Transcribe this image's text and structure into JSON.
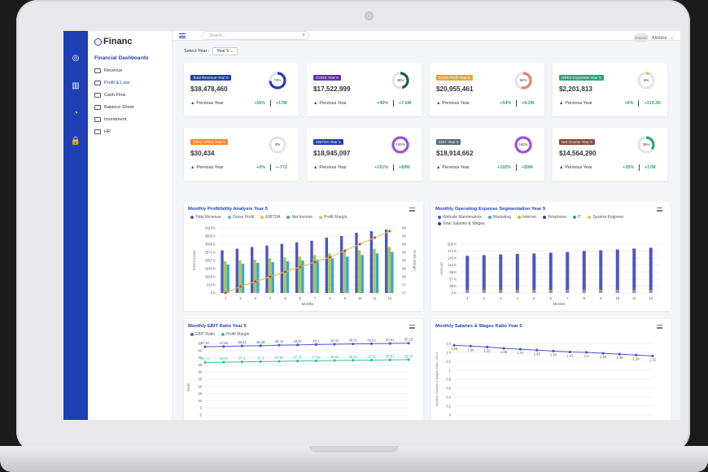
{
  "app": {
    "logo": "Financ",
    "section_title": "Financial Dashboards"
  },
  "sidebar": {
    "items": [
      {
        "label": "Revenue"
      },
      {
        "label": "Profit & Loss"
      },
      {
        "label": "Cash Flow"
      },
      {
        "label": "Balance Sheet"
      },
      {
        "label": "Investment"
      },
      {
        "label": "HR"
      }
    ]
  },
  "topbar": {
    "search_placeholder": "Search...",
    "user_name": "Alishba",
    "avatar_text": "FINANCE"
  },
  "filter": {
    "label": "Select Year :",
    "value": "Year 5"
  },
  "kpis": [
    {
      "title": "Total Revenue Year 5",
      "value": "$38,478,460",
      "pct": "74%",
      "prev": "Pervious Year",
      "g1": "+56%",
      "g2": "+17M",
      "color": "#1e3fb4",
      "fill": 0.74
    },
    {
      "title": "COGS Year 5",
      "value": "$17,522,999",
      "pct": "46%",
      "prev": "Pervious Year",
      "g1": "+46%",
      "g2": "+7.6M",
      "color": "#1a5e55",
      "fill": 0.46
    },
    {
      "title": "Gross Profit Year 5",
      "value": "$20,955,461",
      "pct": "54%",
      "prev": "Pervious Year",
      "g1": "+54%",
      "g2": "+9.3M",
      "color": "#f07d6f",
      "fill": 0.54
    },
    {
      "title": "OPEX Expenses Year 5",
      "value": "$2,201,813",
      "pct": "6%",
      "prev": "Pervious Year",
      "g1": "+6%",
      "g2": "+319.3K",
      "color": "#e8c13a",
      "fill": 0.06
    },
    {
      "title": "Other OPEX Year 5",
      "value": "$30,434",
      "pct": "0%",
      "prev": "Pervious Year",
      "g1": "+0%",
      "g2": "+-771",
      "color": "#f0a03a",
      "fill": 0.0
    },
    {
      "title": "EBITDA Year 5",
      "value": "$18,945,097",
      "pct": "191%",
      "prev": "Pervious Year",
      "g1": "+191%",
      "g2": "+$9M",
      "color": "#9b51e0",
      "fill": 1.0
    },
    {
      "title": "EBIT Year 5",
      "value": "$18,914,662",
      "pct": "192%",
      "prev": "Pervious Year",
      "g1": "+192%",
      "g2": "+$9M",
      "color": "#9b51e0",
      "fill": 1.0
    },
    {
      "title": "Net Income Year 5",
      "value": "$14,564,290",
      "pct": "35%",
      "prev": "Pervious Year",
      "g1": "+35%",
      "g2": "+17M",
      "color": "#2aa676",
      "fill": 0.35
    }
  ],
  "kpi_badge_colors": [
    "#1e3fb4",
    "#5e2fbf",
    "#e8a33a",
    "#2aa676",
    "#f08a2b",
    "#1e3fb4",
    "#556b7a",
    "#8b4a3a"
  ],
  "chart_data": [
    {
      "type": "bar",
      "title": "Monthly Profitibility Analysis Year 5",
      "legend": [
        "Total Revenue",
        "Gross Profit",
        "EBITDA",
        "Net Income",
        "Profit Margin"
      ],
      "legend_colors": [
        "#4b57c7",
        "#6ab2e0",
        "#e8c13a",
        "#3aa6d6",
        "#e8c13a"
      ],
      "categories": [
        "1",
        "2",
        "3",
        "4",
        "5",
        "6",
        "7",
        "8",
        "9",
        "10",
        "11",
        "12"
      ],
      "xlabel": "Months",
      "ylabel": "Total Income",
      "y2label": "Profit Margin",
      "yticks": [
        "0 K",
        "514 K",
        "1029 K",
        "1543 K",
        "2057 K",
        "2571 K",
        "3086 K",
        "3600 K",
        "4114 K"
      ],
      "y2ticks": [
        "37",
        "37",
        "38",
        "38",
        "38",
        "38",
        "39",
        "39",
        "39"
      ],
      "series": [
        {
          "name": "Total Revenue",
          "values": [
            2700,
            2800,
            2900,
            3000,
            3100,
            3200,
            3300,
            3500,
            3600,
            3800,
            3900,
            4000
          ]
        },
        {
          "name": "Gross Profit",
          "values": [
            2000,
            2050,
            2100,
            2200,
            2250,
            2300,
            2400,
            2500,
            2600,
            2700,
            2800,
            2900
          ]
        },
        {
          "name": "Net Income",
          "values": [
            1800,
            1850,
            1900,
            1950,
            2000,
            2050,
            2100,
            2200,
            2300,
            2400,
            2500,
            2600
          ]
        },
        {
          "name": "Profit Margin",
          "values": [
            37.0,
            37.2,
            37.35,
            37.5,
            37.65,
            37.8,
            37.95,
            38.1,
            38.3,
            38.5,
            38.7,
            38.9
          ]
        }
      ],
      "ylim": [
        0,
        4114
      ],
      "y2lim": [
        37,
        39
      ]
    },
    {
      "type": "bar",
      "title": "Monthly Operating Expense Segmentation Year 5",
      "legend": [
        "Website Maintenance",
        "Marketing",
        "Internet",
        "Telephone",
        "IT",
        "System Engineer",
        "Total Salaries & Wages"
      ],
      "legend_colors": [
        "#4b57c7",
        "#3aa6d6",
        "#f0a03a",
        "#1e3fb4",
        "#2aa676",
        "#e8c13a",
        "#1e3fb4"
      ],
      "categories": [
        "1",
        "2",
        "3",
        "4",
        "5",
        "6",
        "7",
        "8",
        "9",
        "10",
        "11",
        "12"
      ],
      "xlabel": "Months",
      "ylabel": "Amount",
      "yticks": [
        "0 K",
        "29 K",
        "57 K",
        "86 K",
        "114 K",
        "143 K",
        "171 K",
        "200 K"
      ],
      "values": [
        152,
        155,
        158,
        160,
        162,
        165,
        168,
        172,
        175,
        178,
        182,
        185
      ],
      "ylim": [
        0,
        200
      ]
    },
    {
      "type": "line",
      "title": "Monthly EBIT Ratio Year 5",
      "legend": [
        "EBIT Ratio",
        "Profit Margin"
      ],
      "legend_colors": [
        "#4b57c7",
        "#2ec4a0"
      ],
      "categories": [
        "1",
        "2",
        "3",
        "4",
        "5",
        "6",
        "7",
        "8",
        "9",
        "10",
        "11",
        "12"
      ],
      "ylabel": "Ratio",
      "yticks": [
        "0",
        "5",
        "10",
        "15",
        "20",
        "25",
        "30",
        "35",
        "40",
        "45",
        "50"
      ],
      "series": [
        {
          "name": "EBIT Ratio",
          "values": [
            47.67,
            47.86,
            48.23,
            48.39,
            48.76,
            48.97,
            49.2,
            49.41,
            49.62,
            49.82,
            50.01,
            50.18
          ],
          "labels": [
            "47.67",
            "47.86",
            "48.23",
            "48.39",
            "48.76",
            "48.97",
            "49.2",
            "49.41",
            "49.62",
            "49.82",
            "50.01",
            "50.18"
          ]
        },
        {
          "name": "Profit Margin",
          "values": [
            36.71,
            36.93,
            37.1,
            37.3,
            37.52,
            37.71,
            37.89,
            38.05,
            38.21,
            38.36,
            38.51,
            38.64
          ],
          "labels": [
            "36.71",
            "36.93",
            "37.1",
            "37.3",
            "37.52",
            "37.71",
            "37.89",
            "38.05",
            "38.21",
            "38.36",
            "38.51",
            "38.64"
          ]
        }
      ],
      "ylim": [
        0,
        50
      ]
    },
    {
      "type": "line",
      "title": "Monthly Salaries & Wages Ratio Year 5",
      "categories": [
        "1",
        "2",
        "3",
        "4",
        "5",
        "6",
        "7",
        "8",
        "9",
        "10",
        "11",
        "12"
      ],
      "ylabel": "Monthly Salaries & Wages Ratio Year 5",
      "yticks": [
        "0",
        "0.2",
        "0.4",
        "0.6",
        "0.8",
        "1",
        "1.2",
        "1.4",
        "1.6"
      ],
      "series": [
        {
          "name": "Salaries & Wages Ratio",
          "values": [
            1.56,
            1.54,
            1.52,
            1.49,
            1.47,
            1.45,
            1.43,
            1.41,
            1.4,
            1.38,
            1.36,
            1.34,
            1.32
          ],
          "labels": [
            "1.56",
            "1.54",
            "1.52",
            "1.49",
            "1.47",
            "1.45",
            "1.43",
            "1.41",
            "1.4",
            "1.38",
            "1.36",
            "1.34",
            "1.32"
          ]
        }
      ],
      "ylim": [
        0,
        1.6
      ]
    }
  ]
}
